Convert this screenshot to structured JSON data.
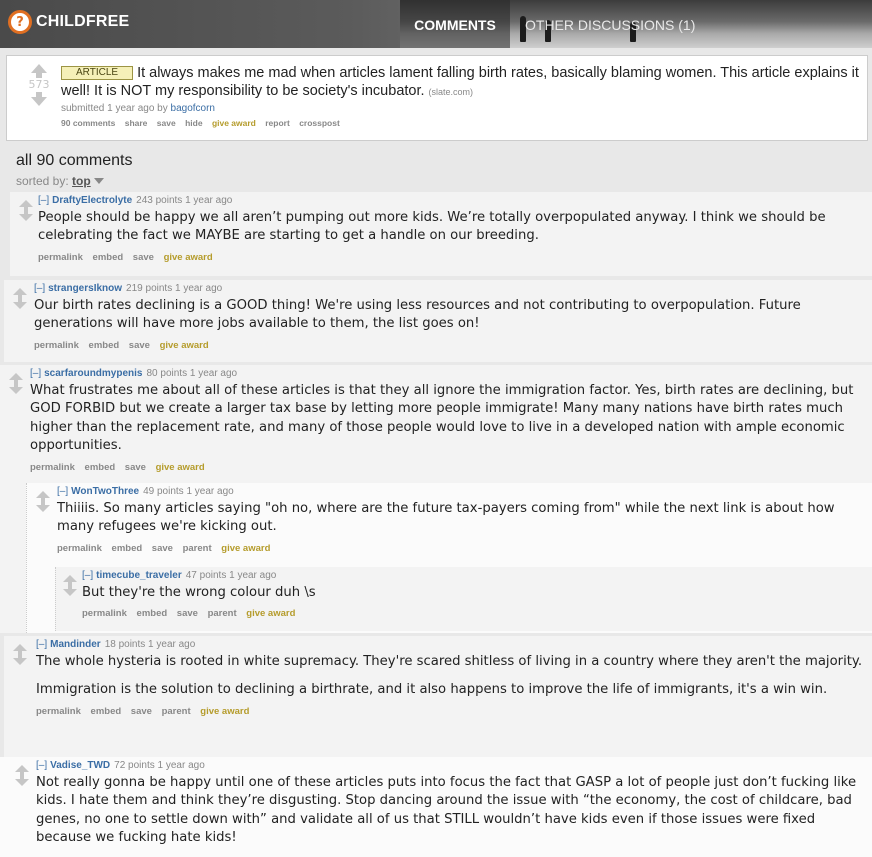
{
  "header": {
    "logo_glyph": "?",
    "title": "CHILDFREE",
    "tab_comments": "COMMENTS",
    "tab_other": "OTHER DISCUSSIONS (1)"
  },
  "post": {
    "score": "573",
    "flair": "ARTICLE",
    "title": "It always makes me mad when articles lament falling birth rates, basically blaming women. This article explains it well! It is NOT my responsibility to be society's incubator.",
    "domain": "(slate.com)",
    "submitted": "submitted 1 year ago by",
    "author": "bagofcorn",
    "buttons": [
      "90 comments",
      "share",
      "save",
      "hide",
      "give award",
      "report",
      "crosspost"
    ]
  },
  "comments_header": {
    "title": "all 90 comments",
    "sorted_label": "sorted by:",
    "sorted_value": "top"
  },
  "comments": [
    {
      "expand": "[–]",
      "author": "DraftyElectrolyte",
      "meta": "243 points 1 year ago",
      "paragraphs": [
        "People should be happy we all aren’t pumping out more kids. We’re totally overpopulated anyway. I think we should be celebrating the fact we MAYBE are starting to get a handle on our breeding."
      ],
      "buttons": [
        "permalink",
        "embed",
        "save",
        "give award"
      ]
    },
    {
      "expand": "[–]",
      "author": "strangersIknow",
      "meta": "219 points 1 year ago",
      "paragraphs": [
        "Our birth rates declining is a GOOD thing! We're using less resources and not contributing to overpopulation. Future generations will have more jobs available to them, the list goes on!"
      ],
      "buttons": [
        "permalink",
        "embed",
        "save",
        "give award"
      ]
    },
    {
      "expand": "[–]",
      "author": "scarfaroundmypenis",
      "meta": "80 points 1 year ago",
      "paragraphs": [
        "What frustrates me about all of these articles is that they all ignore the immigration factor. Yes, birth rates are declining, but GOD FORBID but we create a larger tax base by letting more people immigrate! Many many nations have birth rates much higher than the replacement rate, and many of those people would love to live in a developed nation with ample economic opportunities."
      ],
      "buttons": [
        "permalink",
        "embed",
        "save",
        "give award"
      ]
    },
    {
      "expand": "[–]",
      "author": "WonTwoThree",
      "meta": "49 points 1 year ago",
      "paragraphs": [
        "Thiiiis. So many articles saying \"oh no, where are the future tax-payers coming from\" while the next link is about how many refugees we're kicking out."
      ],
      "buttons": [
        "permalink",
        "embed",
        "save",
        "parent",
        "give award"
      ]
    },
    {
      "expand": "[–]",
      "author": "timecube_traveler",
      "meta": "47 points 1 year ago",
      "paragraphs": [
        "But they're the wrong colour duh \\s"
      ],
      "buttons": [
        "permalink",
        "embed",
        "save",
        "parent",
        "give award"
      ]
    },
    {
      "expand": "[–]",
      "author": "Mandinder",
      "meta": "18 points 1 year ago",
      "paragraphs": [
        "The whole hysteria is rooted in white supremacy. They're scared shitless of living in a country where they aren't the majority.",
        "Immigration is the solution to declining a birthrate, and it also happens to improve the life of immigrants, it's a win win."
      ],
      "buttons": [
        "permalink",
        "embed",
        "save",
        "parent",
        "give award"
      ]
    },
    {
      "expand": "[–]",
      "author": "Vadise_TWD",
      "meta": "72 points 1 year ago",
      "paragraphs": [
        "Not really gonna be happy until one of these articles puts into focus the fact that GASP a lot of people just don’t fucking like kids. I hate them and think they’re disgusting. Stop dancing around the issue with “the economy, the cost of childcare, bad genes, no one to settle down with” and validate all of us that STILL wouldn’t have kids even if those issues were fixed because we fucking hate kids!"
      ],
      "buttons": []
    }
  ],
  "colors": {
    "link": "#3b6ea5",
    "award": "#b59c2c",
    "flair_bg": "#f5f0b8",
    "logo_accent": "#e06f22"
  }
}
